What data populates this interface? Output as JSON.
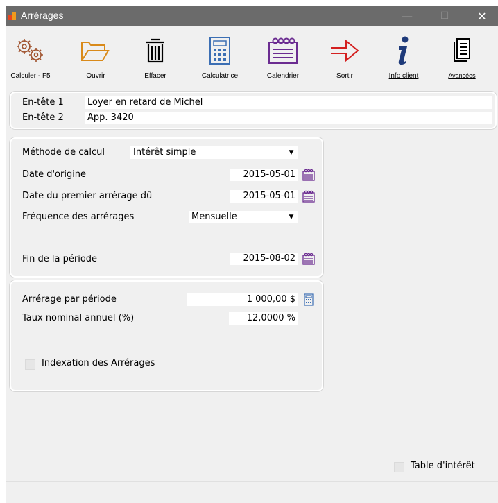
{
  "window": {
    "title": "Arrérages",
    "minimize": "—",
    "maximize": "☐",
    "close": "✕"
  },
  "toolbar": {
    "calculer": "Calculer - F5",
    "ouvrir": "Ouvrir",
    "effacer": "Effacer",
    "calculatrice": "Calculatrice",
    "calendrier": "Calendrier",
    "sortir": "Sortir",
    "info_client": "Info client",
    "avancees": "Avancées"
  },
  "headers": {
    "entete1_label": "En-tête 1",
    "entete1_value": "Loyer en retard de Michel",
    "entete2_label": "En-tête 2",
    "entete2_value": "App. 3420"
  },
  "calcul": {
    "methode_label": "Méthode de calcul",
    "methode_value": "Intérêt simple",
    "date_origine_label": "Date d'origine",
    "date_origine_value": "2015-05-01",
    "date_premier_label": "Date du premier arrérage dû",
    "date_premier_value": "2015-05-01",
    "frequence_label": "Fréquence des arrérages",
    "frequence_value": "Mensuelle",
    "fin_label": "Fin de la période",
    "fin_value": "2015-08-02"
  },
  "montants": {
    "arrerage_label": "Arrérage par période",
    "arrerage_value": "1 000,00 $",
    "taux_label": "Taux nominal annuel (%)",
    "taux_value": "12,0000 %",
    "indexation_label": "Indexation des Arrérages"
  },
  "table_interet_label": "Table d'intérêt",
  "colors": {
    "titlebar": "#6b6b6b",
    "accent_calendar": "#6b2c91",
    "accent_calc": "#3c6fb4",
    "accent_gear": "#a0522d",
    "accent_folder": "#d98a1a",
    "accent_exit": "#d42020"
  }
}
